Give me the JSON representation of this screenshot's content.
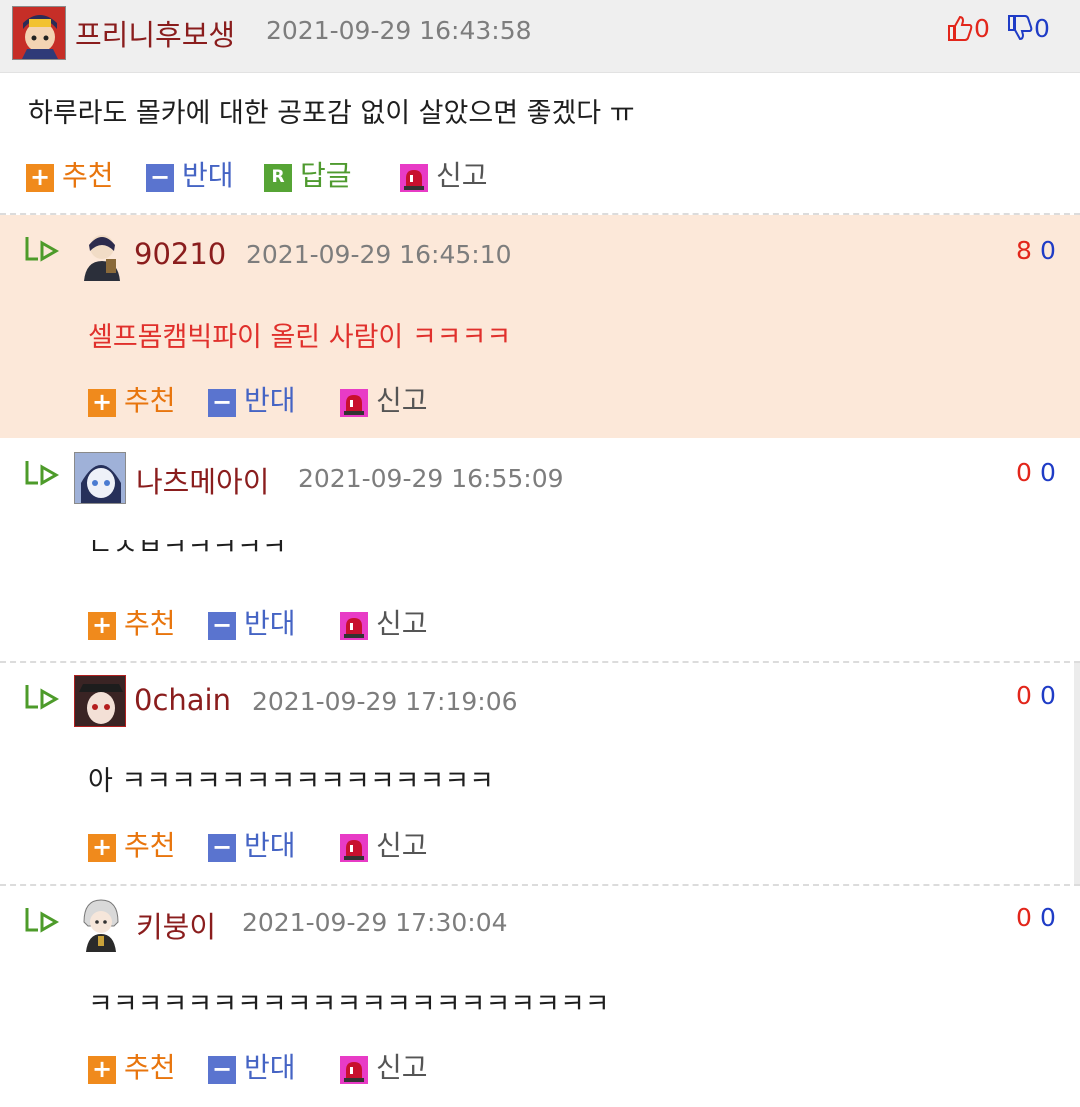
{
  "top": {
    "nick": "프리니후보생",
    "date": "2021-09-29 16:43:58",
    "up": "0",
    "down": "0",
    "body": "하루라도 몰카에 대한 공포감 없이 살았으면 좋겠다 ㅠ"
  },
  "actions": {
    "recommend": "추천",
    "oppose": "반대",
    "reply": "답글",
    "report": "신고",
    "recommend_icon": "+",
    "oppose_icon": "−",
    "reply_icon": "R"
  },
  "replies": [
    {
      "nick": "90210",
      "date": "2021-09-29 16:45:10",
      "up": "8",
      "down": "0",
      "body": "셀프몸캠빅파이 올린 사람이 ㅋㅋㅋㅋ",
      "highlight": true
    },
    {
      "nick": "나츠메아이",
      "date": "2021-09-29 16:55:09",
      "up": "0",
      "down": "0",
      "body": "ㄴㅅㅂㅋㅋㅋㅋㅋ"
    },
    {
      "nick": "0chain",
      "date": "2021-09-29 17:19:06",
      "up": "0",
      "down": "0",
      "body": "아 ㅋㅋㅋㅋㅋㅋㅋㅋㅋㅋㅋㅋㅋㅋㅋ"
    },
    {
      "nick": "키붕이",
      "date": "2021-09-29 17:30:04",
      "up": "0",
      "down": "0",
      "body": "ㅋㅋㅋㅋㅋㅋㅋㅋㅋㅋㅋㅋㅋㅋㅋㅋㅋㅋㅋㅋㅋ"
    }
  ],
  "colors": {
    "nick": "#8a1d1d",
    "up": "#e2261b",
    "down": "#1f3cc6",
    "highlight_bg": "#fce8d9",
    "recommend": "#e8750d",
    "oppose": "#4564c4",
    "reply": "#4f9a2f",
    "report_icon": "#e83bc6"
  },
  "icons": {
    "thumbs_up": "thumbs-up-icon",
    "thumbs_down": "thumbs-down-icon",
    "reply_arrow": "reply-arrow-icon",
    "report": "siren-icon"
  }
}
